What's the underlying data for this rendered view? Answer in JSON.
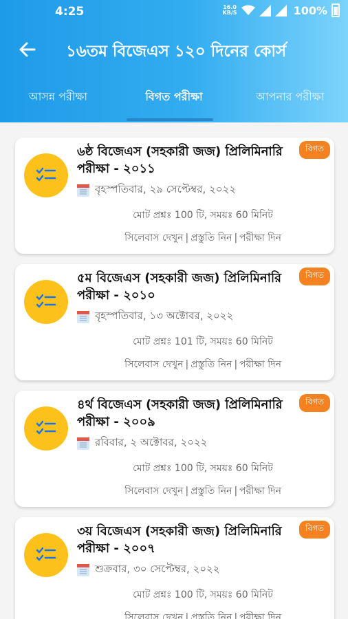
{
  "status_bar": {
    "time": "4:25",
    "speed_value": "16.0",
    "speed_unit": "KB/S",
    "battery": "100%"
  },
  "header": {
    "title": "১৬তম বিজেএস ১২০ দিনের কোর্স"
  },
  "tabs": [
    {
      "label": "আসন্ন পরীক্ষা"
    },
    {
      "label": "বিগত পরীক্ষা"
    },
    {
      "label": "আপনার পরীক্ষা"
    }
  ],
  "colors": {
    "header_start": "#1e9be8",
    "header_end": "#7cd3fb",
    "badge": "#f58220",
    "icon_circle": "#fcc21b"
  },
  "exams": [
    {
      "title": "৬ষ্ঠ বিজেএস (সহকারী জজ) প্রিলিমিনারি পরীক্ষা - ২০১১",
      "date": "বৃহস্পতিবার, ২৯ সেপ্টেম্বর, ২০২২",
      "meta": "মোট প্রশ্নঃ 100 টি, সময়ঃ 60 মিনিট",
      "badge": "বিগত",
      "link_syllabus": "সিলেবাস দেখুন",
      "link_prepare": "প্রস্তুতি নিন",
      "link_exam": "পরীক্ষা দিন"
    },
    {
      "title": "৫ম বিজেএস (সহকারী জজ) প্রিলিমিনারি পরীক্ষা - ২০১০",
      "date": "বৃহস্পতিবার, ১৩ অক্টোবর, ২০২২",
      "meta": "মোট প্রশ্নঃ 101 টি, সময়ঃ 60 মিনিট",
      "badge": "বিগত",
      "link_syllabus": "সিলেবাস দেখুন",
      "link_prepare": "প্রস্তুতি নিন",
      "link_exam": "পরীক্ষা দিন"
    },
    {
      "title": "৪র্থ বিজেএস (সহকারী জজ) প্রিলিমিনারি পরীক্ষা - ২০০৯",
      "date": "রবিবার, ২ অক্টোবর, ২০২২",
      "meta": "মোট প্রশ্নঃ 100 টি, সময়ঃ 60 মিনিট",
      "badge": "বিগত",
      "link_syllabus": "সিলেবাস দেখুন",
      "link_prepare": "প্রস্তুতি নিন",
      "link_exam": "পরীক্ষা দিন"
    },
    {
      "title": "৩য় বিজেএস (সহকারী জজ) প্রিলিমিনারি পরীক্ষা - ২০০৭",
      "date": "শুক্রবার, ৩০ সেপ্টেম্বর, ২০২২",
      "meta": "মোট প্রশ্নঃ 100 টি, সময়ঃ 60 মিনিট",
      "badge": "বিগত",
      "link_syllabus": "সিলেবাস দেখুন",
      "link_prepare": "প্রস্তুতি নিন",
      "link_exam": "পরীক্ষা দিন"
    }
  ]
}
